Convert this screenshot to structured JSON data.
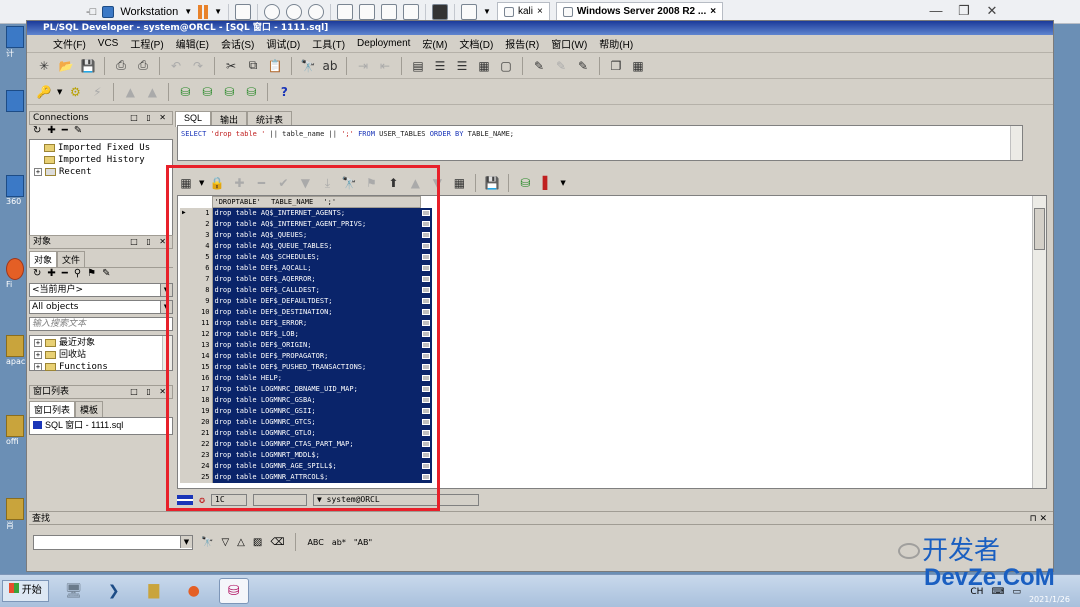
{
  "vmbar": {
    "library_label": "Workstation",
    "tabs": [
      {
        "label": "kali"
      },
      {
        "label": "Windows Server 2008 R2 ..."
      }
    ]
  },
  "desktop": {
    "icons": [
      {
        "label": "计"
      },
      {
        "label": "360"
      },
      {
        "label": "Fi"
      },
      {
        "label": "apach"
      },
      {
        "label": "offi"
      },
      {
        "label": "肖"
      }
    ]
  },
  "app": {
    "title": "PL/SQL Developer - system@ORCL - [SQL 窗口 - 1111.sql]",
    "menu": [
      "文件(F)",
      "VCS",
      "工程(P)",
      "编辑(E)",
      "会话(S)",
      "调试(D)",
      "工具(T)",
      "Deployment",
      "宏(M)",
      "文档(D)",
      "报告(R)",
      "窗口(W)",
      "帮助(H)"
    ]
  },
  "connections": {
    "header": "Connections",
    "items": [
      "Imported Fixed Us",
      "Imported History",
      "Recent"
    ]
  },
  "objects": {
    "header": "对象",
    "tabs": [
      "对象",
      "文件"
    ],
    "user_select": "<当前用户>",
    "filter_select": "All objects",
    "search_placeholder": "输入搜索文本",
    "tree": [
      "最近对象",
      "回收站",
      "Functions"
    ]
  },
  "window_list": {
    "header": "窗口列表",
    "tabs": [
      "窗口列表",
      "模板"
    ],
    "items": [
      "SQL 窗口 - 1111.sql"
    ]
  },
  "editor": {
    "tabs": [
      "SQL",
      "输出",
      "统计表"
    ],
    "sql_select": "SELECT",
    "sql_str1": "'drop  table '",
    "sql_mid": "|| table_name || ",
    "sql_str2": "';'",
    "sql_from": "FROM",
    "sql_table": "USER_TABLES",
    "sql_order": "ORDER BY",
    "sql_tail": "TABLE_NAME;"
  },
  "grid": {
    "columns": [
      "'DROPTABLE'",
      "TABLE_NAME",
      "';'"
    ],
    "rows": [
      "drop  table AQ$_INTERNET_AGENTS;",
      "drop  table AQ$_INTERNET_AGENT_PRIVS;",
      "drop  table AQ$_QUEUES;",
      "drop  table AQ$_QUEUE_TABLES;",
      "drop  table AQ$_SCHEDULES;",
      "drop  table DEF$_AQCALL;",
      "drop  table DEF$_AQERROR;",
      "drop  table DEF$_CALLDEST;",
      "drop  table DEF$_DEFAULTDEST;",
      "drop  table DEF$_DESTINATION;",
      "drop  table DEF$_ERROR;",
      "drop  table DEF$_LOB;",
      "drop  table DEF$_ORIGIN;",
      "drop  table DEF$_PROPAGATOR;",
      "drop  table DEF$_PUSHED_TRANSACTIONS;",
      "drop  table HELP;",
      "drop  table LOGMNRC_DBNAME_UID_MAP;",
      "drop  table LOGMNRC_GSBA;",
      "drop  table LOGMNRC_GSII;",
      "drop  table LOGMNRC_GTCS;",
      "drop  table LOGMNRC_GTLO;",
      "drop  table LOGMNRP_CTAS_PART_MAP;",
      "drop  table LOGMNRT_MDDL$;",
      "drop  table LOGMNR_AGE_SPILL$;",
      "drop  table LOGMNR_ATTRCOL$;"
    ]
  },
  "status": {
    "position": "1C",
    "connection": "system@ORCL"
  },
  "find": {
    "header": "查找",
    "opt_abc": "ABC",
    "opt_quoted": "\"AB\""
  },
  "taskbar": {
    "start_label": "开始",
    "tray_lang": "CH",
    "date": "2021/1/26"
  },
  "watermark": {
    "cn": "开发者",
    "en": "DevZe.CoM"
  },
  "colors": {
    "selection": "#0a246a",
    "highlight_box": "#e8202a",
    "keyword": "#1a35b8"
  }
}
